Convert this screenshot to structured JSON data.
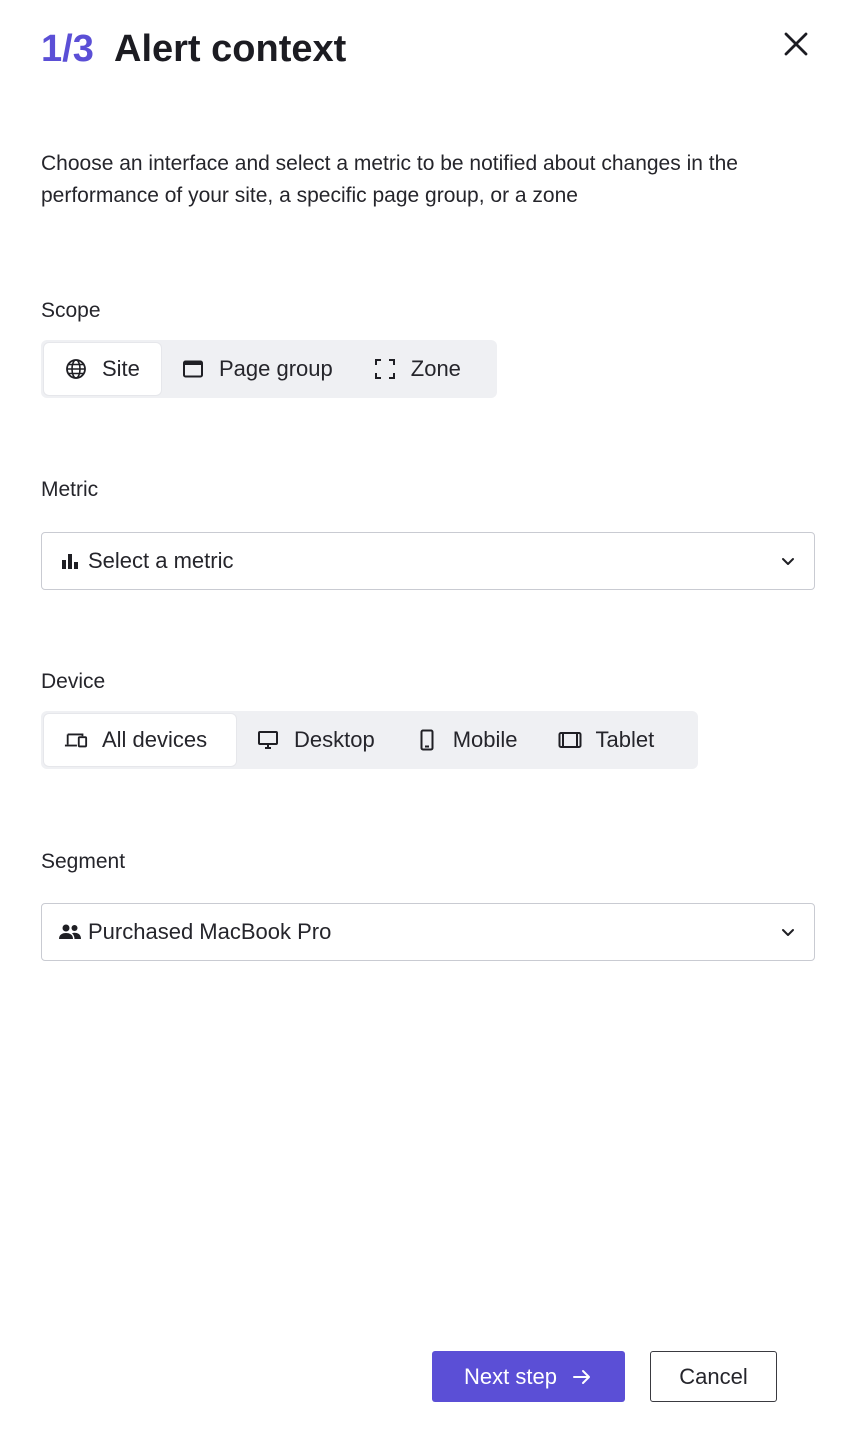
{
  "header": {
    "step": "1/3",
    "title": "Alert context",
    "close_icon": "close-icon"
  },
  "intro": "Choose an interface and select a metric to be notified about changes in the performance of your site, a specific page group, or a zone",
  "scope": {
    "label": "Scope",
    "options": [
      {
        "label": "Site",
        "icon": "globe-icon",
        "selected": true
      },
      {
        "label": "Page group",
        "icon": "browser-window-icon",
        "selected": false
      },
      {
        "label": "Zone",
        "icon": "zone-frame-icon",
        "selected": false
      }
    ]
  },
  "metric": {
    "label": "Metric",
    "value": "Select a metric",
    "icon": "bar-chart-icon"
  },
  "device": {
    "label": "Device",
    "options": [
      {
        "label": "All devices",
        "icon": "all-devices-icon",
        "selected": true
      },
      {
        "label": "Desktop",
        "icon": "desktop-icon",
        "selected": false
      },
      {
        "label": "Mobile",
        "icon": "mobile-icon",
        "selected": false
      },
      {
        "label": "Tablet",
        "icon": "tablet-icon",
        "selected": false
      }
    ]
  },
  "segment": {
    "label": "Segment",
    "value": "Purchased MacBook Pro",
    "icon": "users-icon"
  },
  "footer": {
    "next_label": "Next step",
    "cancel_label": "Cancel"
  },
  "colors": {
    "accent": "#5b4fd6",
    "segment_bg": "#eff0f3",
    "border": "#c9cbd2"
  }
}
